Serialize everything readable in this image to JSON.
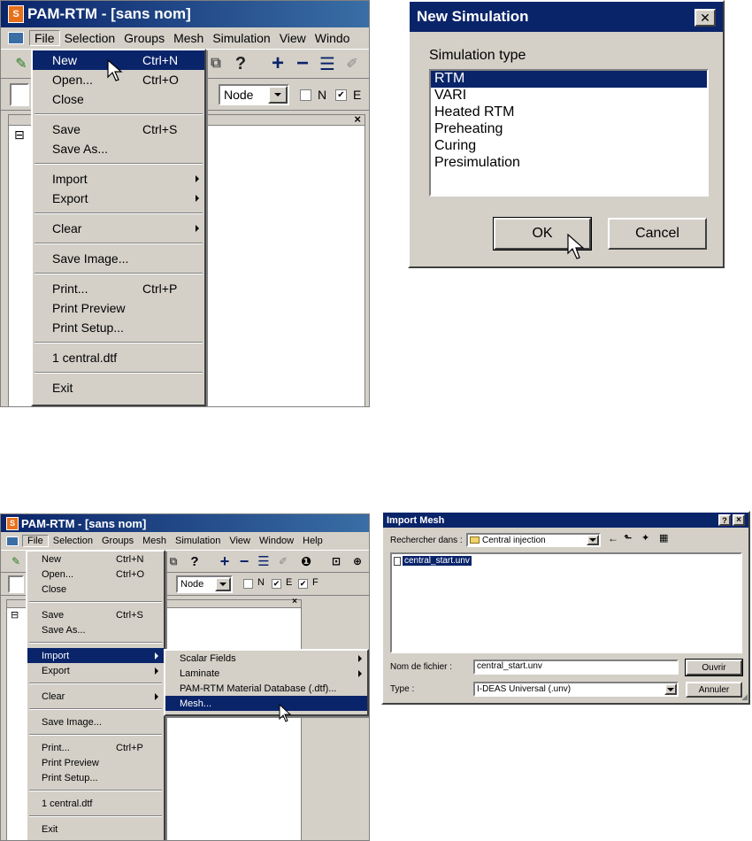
{
  "app": {
    "title": "PAM-RTM - [sans nom]",
    "icon_letter": "S",
    "menubar": [
      "File",
      "Selection",
      "Groups",
      "Mesh",
      "Simulation",
      "View",
      "Window",
      "Help"
    ],
    "menubar_cut": [
      "File",
      "Selection",
      "Groups",
      "Mesh",
      "Simulation",
      "View",
      "Windo"
    ],
    "entity_select": "Node",
    "checks": [
      {
        "label": "N",
        "checked": false
      },
      {
        "label": "E",
        "checked": true
      },
      {
        "label": "F",
        "checked": true
      }
    ],
    "tree_expander": "⊟",
    "pane_close": "×"
  },
  "file_menu": {
    "items": [
      {
        "label": "New",
        "shortcut": "Ctrl+N"
      },
      {
        "label": "Open...",
        "shortcut": "Ctrl+O"
      },
      {
        "label": "Close",
        "shortcut": ""
      },
      {
        "label": "Save",
        "shortcut": "Ctrl+S"
      },
      {
        "label": "Save As...",
        "shortcut": ""
      },
      {
        "label": "Import",
        "shortcut": ""
      },
      {
        "label": "Export",
        "shortcut": ""
      },
      {
        "label": "Clear",
        "shortcut": ""
      },
      {
        "label": "Save Image...",
        "shortcut": ""
      },
      {
        "label": "Print...",
        "shortcut": "Ctrl+P"
      },
      {
        "label": "Print Preview",
        "shortcut": ""
      },
      {
        "label": "Print Setup...",
        "shortcut": ""
      },
      {
        "label": "1 central.dtf",
        "shortcut": ""
      },
      {
        "label": "Exit",
        "shortcut": ""
      }
    ]
  },
  "import_submenu": {
    "items": [
      "Scalar Fields",
      "Laminate",
      "PAM-RTM Material Database (.dtf)...",
      "Mesh..."
    ]
  },
  "new_simulation": {
    "title": "New Simulation",
    "close": "✕",
    "label": "Simulation type",
    "options": [
      "RTM",
      "VARI",
      "Heated RTM",
      "Preheating",
      "Curing",
      "Presimulation"
    ],
    "selected": "RTM",
    "ok": "OK",
    "cancel": "Cancel"
  },
  "import_mesh": {
    "title": "Import Mesh",
    "help": "?",
    "close": "×",
    "look_in_label": "Rechercher dans :",
    "look_in_value": "Central injection",
    "files": [
      "central_start.unv"
    ],
    "filename_label": "Nom de fichier :",
    "filename_value": "central_start.unv",
    "type_label": "Type :",
    "type_value": "I-DEAS Universal (.unv)",
    "open_button": "Ouvrir",
    "cancel_button": "Annuler"
  },
  "colors": {
    "titlebar": "#0a246a",
    "highlight": "#0a246a",
    "face": "#d4d0c8",
    "app_icon": "#e8701a"
  }
}
